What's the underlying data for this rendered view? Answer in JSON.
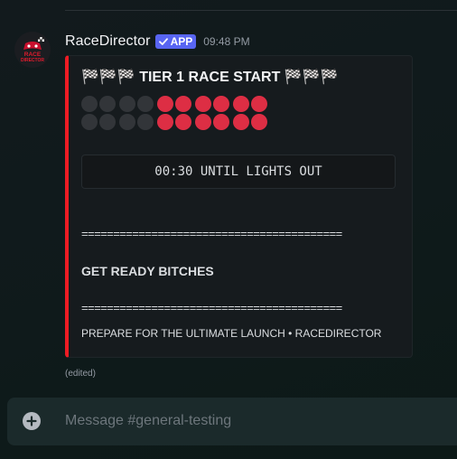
{
  "message": {
    "username": "RaceDirector",
    "app_tag": "APP",
    "timestamp": "09:48 PM",
    "edited_label": "(edited)",
    "avatar": {
      "icon": "racedirector-logo",
      "text_top": "RACE",
      "text_bottom": "DIRECTOR"
    }
  },
  "embed": {
    "accent_color": "#ed1c24",
    "title": "🏁🏁🏁 TIER 1 RACE START 🏁🏁🏁",
    "lights": {
      "rows": [
        [
          "off",
          "off",
          "off",
          "off",
          "on",
          "on",
          "on",
          "on",
          "on",
          "on"
        ],
        [
          "off",
          "off",
          "off",
          "off",
          "on",
          "on",
          "on",
          "on",
          "on",
          "on"
        ]
      ],
      "on_color": "#dd2e44",
      "off_color": "#323539"
    },
    "countdown": "00:30 UNTIL LIGHTS OUT",
    "separator": "=========================================",
    "shout": "GET READY BITCHES",
    "footer": "PREPARE FOR THE ULTIMATE LAUNCH • RACEDIRECTOR"
  },
  "composer": {
    "placeholder": "Message #general-testing",
    "add_icon": "plus-circle-icon"
  },
  "colors": {
    "brand_app_tag": "#5865f2"
  }
}
